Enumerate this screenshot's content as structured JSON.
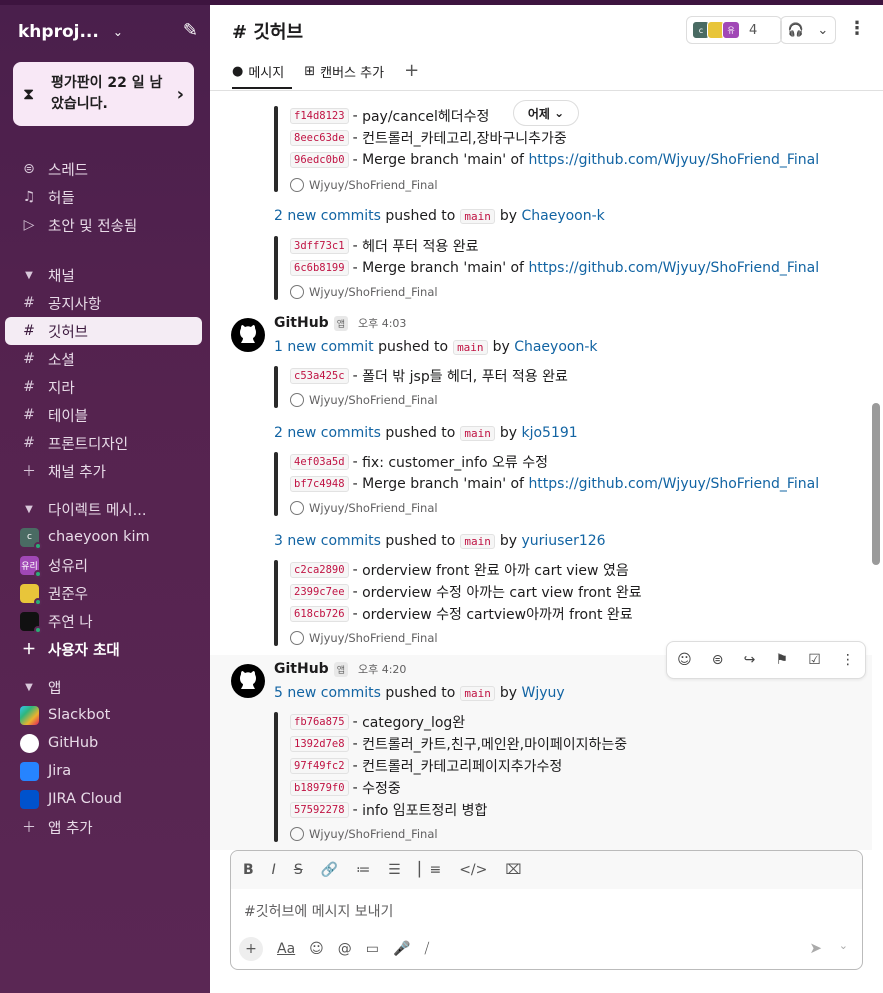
{
  "sidebar": {
    "workspace": "khproj...",
    "trial": "평가판이 22 일 남았습니다.",
    "top_nav": [
      {
        "icon": "thread-icon",
        "glyph": "⌕",
        "label": "스레드"
      },
      {
        "icon": "headphones-icon",
        "glyph": "🎧",
        "label": "허들"
      },
      {
        "icon": "send-icon",
        "glyph": "▷",
        "label": "초안 및 전송됨"
      }
    ],
    "channels_header": "채널",
    "channels": [
      "공지사항",
      "깃허브",
      "소셜",
      "지라",
      "테이블",
      "프론트디자인"
    ],
    "active_channel_index": 1,
    "add_channel": "채널 추가",
    "dm_header": "다이렉트 메시...",
    "dms": [
      {
        "name": "chaeyoon kim",
        "avatar_text": "c",
        "color": "#4a6b63"
      },
      {
        "name": "성유리",
        "avatar_text": "유리",
        "color": "#a148b6"
      },
      {
        "name": "권준우",
        "avatar_text": "",
        "color": "#e8c53a"
      },
      {
        "name": "주연  나",
        "avatar_text": "",
        "color": "#111111"
      }
    ],
    "invite": "사용자 초대",
    "apps_header": "앱",
    "apps": [
      {
        "name": "Slackbot",
        "color": "#36c5f0"
      },
      {
        "name": "GitHub",
        "color": "#ffffff"
      },
      {
        "name": "Jira",
        "color": "#2684ff"
      },
      {
        "name": "JIRA Cloud",
        "color": "#0052cc"
      }
    ],
    "add_app": "앱 추가"
  },
  "header": {
    "channel": "깃허브",
    "member_count": "4",
    "tabs": [
      "메시지",
      "캔버스 추가"
    ]
  },
  "feed": {
    "date_pill": "어제",
    "repo": "Wjyuy/ShoFriend_Final",
    "repo_url": "https://github.com/Wjyuy/ShoFriend_Final",
    "merge_prefix": "Merge branch 'main' of",
    "sender": "GitHub",
    "app_badge": "앱",
    "pushed_to": "pushed to",
    "by": "by",
    "branch": "main",
    "block0": {
      "commits": [
        {
          "sha": "f14d8123",
          "msg": "pay/cancel헤더수정"
        },
        {
          "sha": "8eec63de",
          "msg": "컨트롤러_카테고리,장바구니추가중"
        },
        {
          "sha": "96edc0b0",
          "msg": "merge"
        }
      ]
    },
    "block1": {
      "count_text": "2 new commits",
      "author": "Chaeyoon-k",
      "commits": [
        {
          "sha": "3dff73c1",
          "msg": "헤더 푸터 적용 완료"
        },
        {
          "sha": "6c6b8199",
          "msg": "merge"
        }
      ]
    },
    "msg2": {
      "time": "오후 4:03",
      "count_text": "1 new commit",
      "author": "Chaeyoon-k",
      "commits": [
        {
          "sha": "c53a425c",
          "msg": "폴더 밖 jsp들 헤더, 푸터 적용 완료"
        }
      ]
    },
    "block3": {
      "count_text": "2 new commits",
      "author": "kjo5191",
      "commits": [
        {
          "sha": "4ef03a5d",
          "msg": "fix: customer_info 오류 수정"
        },
        {
          "sha": "bf7c4948",
          "msg": "merge"
        }
      ]
    },
    "block4": {
      "count_text": "3 new commits",
      "author": "yuriuser126",
      "commits": [
        {
          "sha": "c2ca2890",
          "msg": "orderview front 완료 아까 cart view 였음"
        },
        {
          "sha": "2399c7ee",
          "msg": "orderview 수정 아까는 cart view front 완료"
        },
        {
          "sha": "618cb726",
          "msg": "orderview 수정 cartview아까꺼 front 완료"
        }
      ]
    },
    "msg5": {
      "time": "오후 4:20",
      "count_text": "5 new commits",
      "author": "Wjyuy",
      "commits": [
        {
          "sha": "fb76a875",
          "msg": "category_log완"
        },
        {
          "sha": "1392d7e8",
          "msg": "컨트롤러_카트,친구,메인완,마이페이지하는중"
        },
        {
          "sha": "97f49fc2",
          "msg": "컨트롤러_카테고리페이지추가수정"
        },
        {
          "sha": "b18979f0",
          "msg": "수정중"
        },
        {
          "sha": "57592278",
          "msg": "info 임포트정리 병합"
        }
      ]
    }
  },
  "composer": {
    "placeholder": "#깃허브에 메시지 보내기",
    "aa_label": "Aa"
  }
}
